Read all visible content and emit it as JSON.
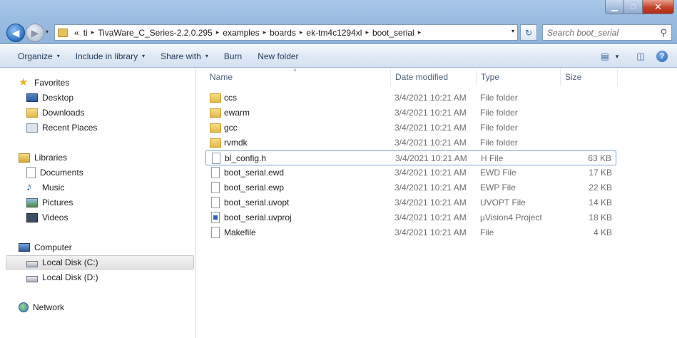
{
  "window": {
    "controls": {
      "minimize": "▁",
      "maximize": "□",
      "close": "✕"
    }
  },
  "nav": {
    "back": "◀",
    "forward": "▶",
    "history": "▾"
  },
  "address": {
    "overflow": "«",
    "crumbs": [
      "ti",
      "TivaWare_C_Series-2.2.0.295",
      "examples",
      "boards",
      "ek-tm4c1294xl",
      "boot_serial"
    ],
    "separator": "▸",
    "dropdown": "▾"
  },
  "refresh": "↻",
  "search": {
    "placeholder": "Search boot_serial",
    "icon": "⚲"
  },
  "toolbar": {
    "organize": "Organize",
    "include_in_library": "Include in library",
    "share_with": "Share with",
    "burn": "Burn",
    "new_folder": "New folder",
    "caret": "▾",
    "view_icon": "▤",
    "view_caret": "▾",
    "preview_icon": "◫",
    "help": "?"
  },
  "sidebar": {
    "favorites": {
      "label": "Favorites",
      "items": [
        "Desktop",
        "Downloads",
        "Recent Places"
      ]
    },
    "libraries": {
      "label": "Libraries",
      "items": [
        "Documents",
        "Music",
        "Pictures",
        "Videos"
      ]
    },
    "computer": {
      "label": "Computer",
      "items": [
        "Local Disk (C:)",
        "Local Disk (D:)"
      ]
    },
    "network": {
      "label": "Network"
    }
  },
  "columns": {
    "name": "Name",
    "date": "Date modified",
    "type": "Type",
    "size": "Size",
    "sort_caret": "˄"
  },
  "files": [
    {
      "name": "ccs",
      "date": "3/4/2021 10:21 AM",
      "type": "File folder",
      "size": "",
      "icon": "folder-icon"
    },
    {
      "name": "ewarm",
      "date": "3/4/2021 10:21 AM",
      "type": "File folder",
      "size": "",
      "icon": "folder-icon"
    },
    {
      "name": "gcc",
      "date": "3/4/2021 10:21 AM",
      "type": "File folder",
      "size": "",
      "icon": "folder-icon"
    },
    {
      "name": "rvmdk",
      "date": "3/4/2021 10:21 AM",
      "type": "File folder",
      "size": "",
      "icon": "folder-icon"
    },
    {
      "name": "bl_config.h",
      "date": "3/4/2021 10:21 AM",
      "type": "H File",
      "size": "63 KB",
      "icon": "file-icon"
    },
    {
      "name": "boot_serial.ewd",
      "date": "3/4/2021 10:21 AM",
      "type": "EWD File",
      "size": "17 KB",
      "icon": "file-icon"
    },
    {
      "name": "boot_serial.ewp",
      "date": "3/4/2021 10:21 AM",
      "type": "EWP File",
      "size": "22 KB",
      "icon": "file-icon"
    },
    {
      "name": "boot_serial.uvopt",
      "date": "3/4/2021 10:21 AM",
      "type": "UVOPT File",
      "size": "14 KB",
      "icon": "file-icon"
    },
    {
      "name": "boot_serial.uvproj",
      "date": "3/4/2021 10:21 AM",
      "type": "µVision4 Project",
      "size": "18 KB",
      "icon": "project-file-icon"
    },
    {
      "name": "Makefile",
      "date": "3/4/2021 10:21 AM",
      "type": "File",
      "size": "4 KB",
      "icon": "file-icon"
    }
  ]
}
